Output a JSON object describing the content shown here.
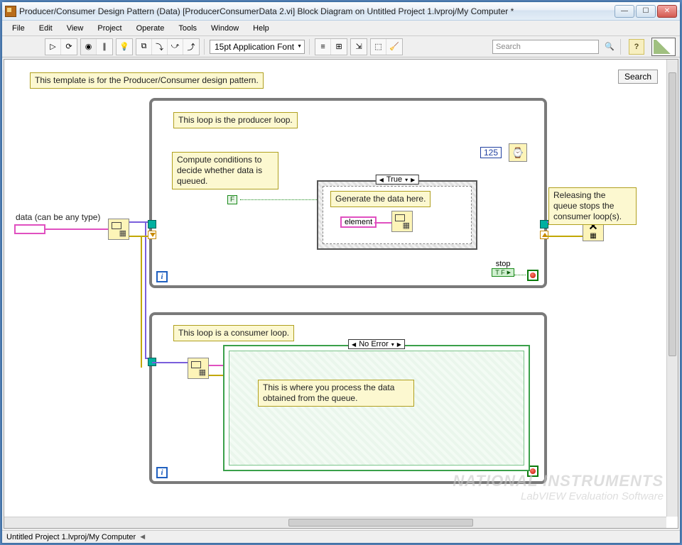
{
  "window": {
    "title": "Producer/Consumer Design Pattern (Data) [ProducerConsumerData 2.vi] Block Diagram on Untitled Project 1.lvproj/My Computer *"
  },
  "menus": [
    "File",
    "Edit",
    "View",
    "Project",
    "Operate",
    "Tools",
    "Window",
    "Help"
  ],
  "toolbar": {
    "font": "15pt Application Font",
    "search_placeholder": "Search",
    "help_label": "?"
  },
  "diagram": {
    "template_comment": "This template is for the Producer/Consumer design pattern.",
    "search_btn": "Search",
    "data_label": "data (can be any type)",
    "producer": {
      "title": "This loop is the producer loop.",
      "compute": "Compute conditions to decide whether data is queued.",
      "case_selector": "True",
      "generate": "Generate the data here.",
      "element": "element",
      "wait_ms": "125",
      "stop_label": "stop",
      "stop_tf": "T F",
      "bool_const": "F"
    },
    "release_comment": "Releasing the queue stops the consumer loop(s).",
    "consumer": {
      "title": "This loop is a consumer loop.",
      "case_selector": "No Error",
      "process": "This is where you process the data obtained from the queue."
    }
  },
  "statusbar": {
    "path": "Untitled Project 1.lvproj/My Computer"
  },
  "watermark": {
    "brand": "NATIONAL INSTRUMENTS",
    "product": "LabVIEW  Evaluation Software"
  }
}
